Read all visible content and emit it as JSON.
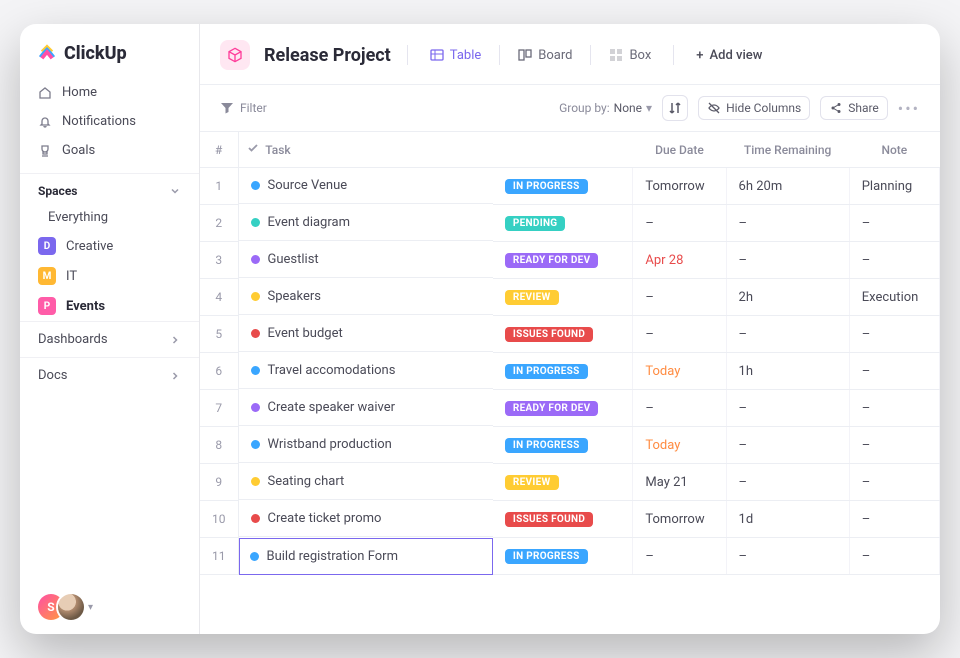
{
  "app": {
    "name": "ClickUp"
  },
  "sidebar": {
    "nav": [
      {
        "label": "Home",
        "icon": "home"
      },
      {
        "label": "Notifications",
        "icon": "bell"
      },
      {
        "label": "Goals",
        "icon": "trophy"
      }
    ],
    "spaces_title": "Spaces",
    "everything_label": "Everything",
    "spaces": [
      {
        "letter": "D",
        "label": "Creative",
        "color": "#7b68ee"
      },
      {
        "letter": "M",
        "label": "IT",
        "color": "#ffb833"
      },
      {
        "letter": "P",
        "label": "Events",
        "color": "#ff5ca8",
        "active": true
      }
    ],
    "dashboards_label": "Dashboards",
    "docs_label": "Docs",
    "avatar_initial": "S"
  },
  "header": {
    "project_title": "Release Project",
    "views": [
      {
        "label": "Table",
        "active": true,
        "icon": "table"
      },
      {
        "label": "Board",
        "icon": "board"
      },
      {
        "label": "Box",
        "icon": "box"
      }
    ],
    "add_view_label": "Add view"
  },
  "toolbar": {
    "filter_label": "Filter",
    "groupby_label": "Group by:",
    "groupby_value": "None",
    "hide_columns_label": "Hide Columns",
    "share_label": "Share"
  },
  "table": {
    "headers": {
      "num": "#",
      "task": "Task",
      "due": "Due Date",
      "time": "Time Remaining",
      "note": "Note"
    },
    "rows": [
      {
        "n": "1",
        "task": "Source Venue",
        "status": "IN PROGRESS",
        "status_color": "#3aa6ff",
        "dot": "#3aa6ff",
        "due": "Tomorrow",
        "due_class": "",
        "time": "6h 20m",
        "note": "Planning"
      },
      {
        "n": "2",
        "task": "Event diagram",
        "status": "PENDING",
        "status_color": "#35d0c3",
        "dot": "#35d0c3",
        "due": "–",
        "time": "–",
        "note": "–"
      },
      {
        "n": "3",
        "task": "Guestlist",
        "status": "READY FOR DEV",
        "status_color": "#9b6af7",
        "dot": "#9b6af7",
        "due": "Apr 28",
        "due_class": "due-danger",
        "time": "–",
        "note": "–"
      },
      {
        "n": "4",
        "task": "Speakers",
        "status": "REVIEW",
        "status_color": "#ffcc33",
        "dot": "#ffcc33",
        "due": "–",
        "time": "2h",
        "note": "Execution"
      },
      {
        "n": "5",
        "task": "Event budget",
        "status": "ISSUES FOUND",
        "status_color": "#e84b4b",
        "dot": "#e84b4b",
        "due": "–",
        "time": "–",
        "note": "–"
      },
      {
        "n": "6",
        "task": "Travel accomodations",
        "status": "IN PROGRESS",
        "status_color": "#3aa6ff",
        "dot": "#3aa6ff",
        "due": "Today",
        "due_class": "due-warn",
        "time": "1h",
        "note": "–"
      },
      {
        "n": "7",
        "task": "Create speaker waiver",
        "status": "READY FOR DEV",
        "status_color": "#9b6af7",
        "dot": "#9b6af7",
        "due": "–",
        "time": "–",
        "note": "–"
      },
      {
        "n": "8",
        "task": "Wristband production",
        "status": "IN PROGRESS",
        "status_color": "#3aa6ff",
        "dot": "#3aa6ff",
        "due": "Today",
        "due_class": "due-warn",
        "time": "–",
        "note": "–"
      },
      {
        "n": "9",
        "task": "Seating chart",
        "status": "REVIEW",
        "status_color": "#ffcc33",
        "dot": "#ffcc33",
        "due": "May 21",
        "time": "–",
        "note": "–"
      },
      {
        "n": "10",
        "task": "Create ticket promo",
        "status": "ISSUES FOUND",
        "status_color": "#e84b4b",
        "dot": "#e84b4b",
        "due": "Tomorrow",
        "time": "1d",
        "note": "–"
      },
      {
        "n": "11",
        "task": "Build registration Form",
        "status": "IN PROGRESS",
        "status_color": "#3aa6ff",
        "dot": "#3aa6ff",
        "due": "–",
        "time": "–",
        "note": "–",
        "editing": true
      }
    ]
  }
}
